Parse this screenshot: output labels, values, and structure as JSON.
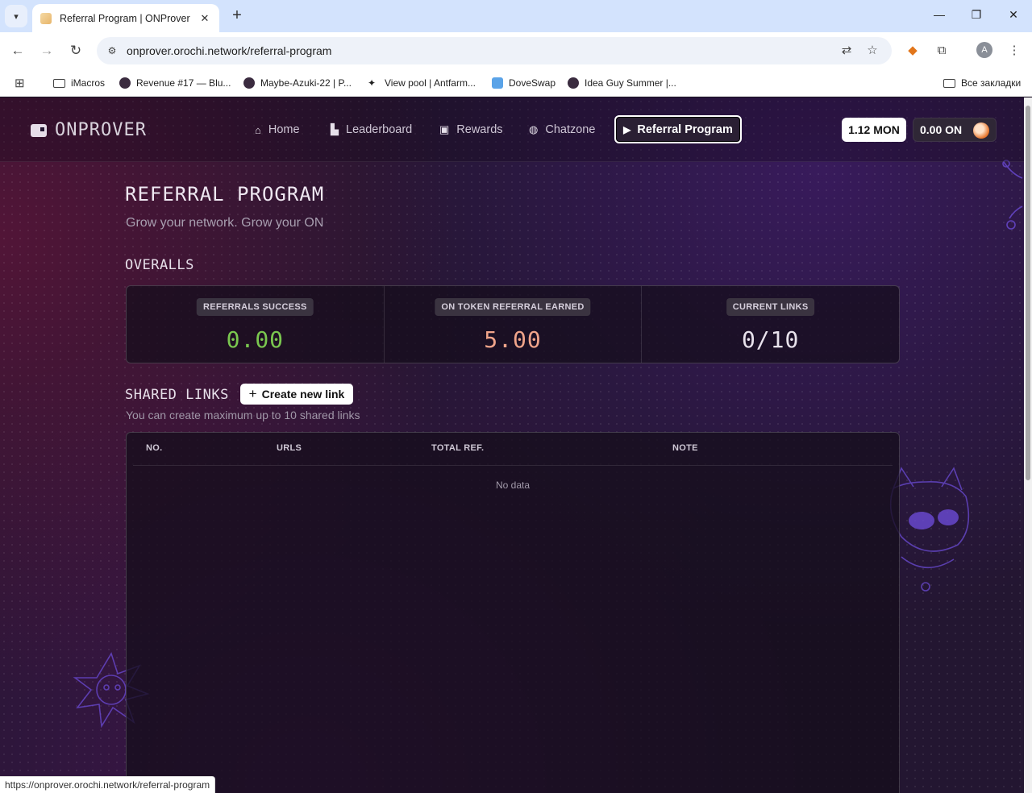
{
  "browser": {
    "tab_title": "Referral Program | ONProver",
    "url": "onprover.orochi.network/referral-program",
    "status_url": "https://onprover.orochi.network/referral-program",
    "bookmarks": [
      {
        "label": "iMacros",
        "icon": "folder-icon"
      },
      {
        "label": "Revenue #17 — Blu...",
        "icon": "eye-avatar-icon"
      },
      {
        "label": "Maybe-Azuki-22 | P...",
        "icon": "eye-avatar-icon"
      },
      {
        "label": "View pool | Antfarm...",
        "icon": "antfarm-icon"
      },
      {
        "label": "DoveSwap",
        "icon": "doveswap-icon"
      },
      {
        "label": "Idea Guy Summer |...",
        "icon": "eye-avatar-icon"
      }
    ],
    "all_bookmarks_label": "Все закладки",
    "profile_initial": "A"
  },
  "site": {
    "logo": "ONPROVER",
    "nav": [
      {
        "label": "Home",
        "icon": "home-icon"
      },
      {
        "label": "Leaderboard",
        "icon": "leaderboard-icon"
      },
      {
        "label": "Rewards",
        "icon": "rewards-icon"
      },
      {
        "label": "Chatzone",
        "icon": "chat-icon"
      },
      {
        "label": "Referral Program",
        "icon": "megaphone-icon",
        "active": true
      }
    ],
    "balance_mon": "1.12 MON",
    "balance_on": "0.00 ON"
  },
  "page": {
    "title": "REFERRAL PROGRAM",
    "subtitle": "Grow your network. Grow your ON",
    "overalls_title": "OVERALLS",
    "stats": [
      {
        "label": "REFERRALS SUCCESS",
        "value": "0.00",
        "color": "#7ac74f"
      },
      {
        "label": "ON TOKEN REFERRAL EARNED",
        "value": "5.00",
        "color": "#f0a48a"
      },
      {
        "label": "CURRENT LINKS",
        "value": "0/10",
        "color": "#e8e2ec"
      }
    ],
    "shared_links_title": "SHARED LINKS",
    "create_button": "Create new link",
    "links_note": "You can create maximum up to 10 shared links",
    "table": {
      "columns": [
        "NO.",
        "URLS",
        "TOTAL REF.",
        "NOTE"
      ],
      "rows": [],
      "empty_text": "No data"
    }
  },
  "colors": {
    "accent_green": "#7ac74f",
    "accent_orange": "#f0a48a",
    "background": "#231631"
  }
}
